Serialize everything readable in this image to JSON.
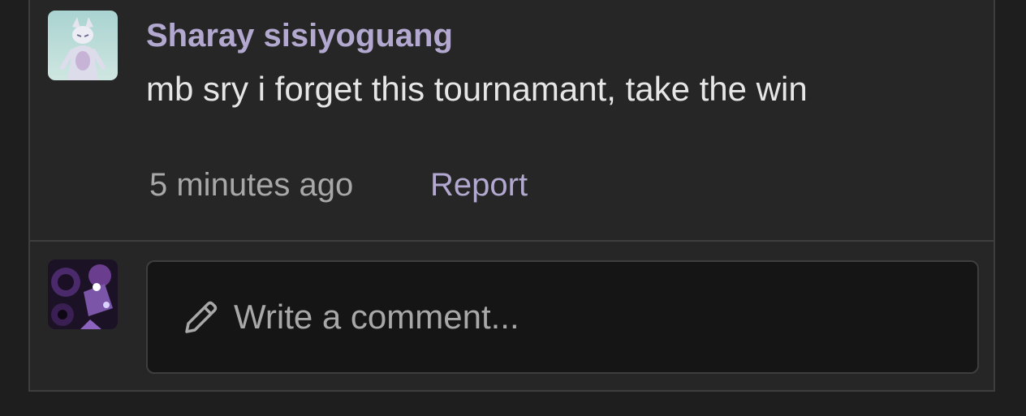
{
  "comment": {
    "author": "Sharay sisiyoguang",
    "text": "mb sry i forget this tournamant, take the win",
    "timestamp": "5 minutes ago",
    "report_label": "Report",
    "avatar_icon": "author-avatar-image"
  },
  "composer": {
    "placeholder": "Write a comment...",
    "value": "",
    "icon": "pencil-icon",
    "avatar_icon": "current-user-avatar-image"
  },
  "colors": {
    "accent": "#b3a8cf",
    "panel_bg": "#262626",
    "input_bg": "#151515",
    "border": "#3e3e3e",
    "text_primary": "#e6e6e6",
    "text_muted": "#a8a8a8"
  }
}
